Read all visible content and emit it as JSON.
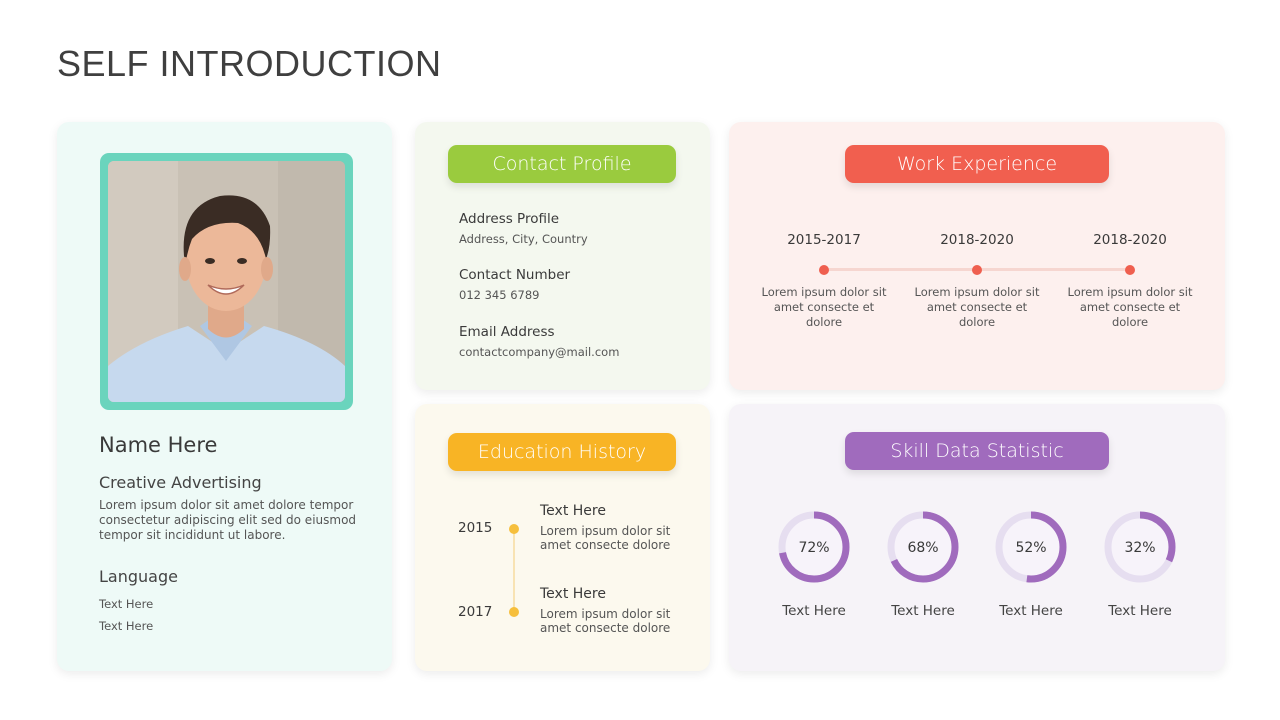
{
  "page": {
    "title": "SELF INTRODUCTION"
  },
  "colors": {
    "profile_bg": "#eefaf7",
    "photo_frame": "#6ad4bd",
    "contact_accent": "#9acb3e",
    "work_accent": "#f15f4f",
    "education_accent": "#f8b425",
    "skill_accent": "#a06bbd",
    "skill_track": "#e6def0"
  },
  "profile": {
    "photo_alt": "Smiling young man in light blue shirt",
    "name": "Name Here",
    "role": "Creative Advertising",
    "bio": "Lorem ipsum dolor sit amet dolore tempor consectetur adipiscing elit sed do eiusmod tempor  sit  incididunt ut labore.",
    "language_title": "Language",
    "languages": [
      "Text Here",
      "Text Here"
    ]
  },
  "contact": {
    "title": "Contact Profile",
    "items": [
      {
        "label": "Address Profile",
        "value": "Address,  City, Country"
      },
      {
        "label": "Contact Number",
        "value": "012 345 6789"
      },
      {
        "label": "Email Address",
        "value": "contactcompany@mail.com"
      }
    ]
  },
  "work": {
    "title": "Work Experience",
    "items": [
      {
        "years": "2015-2017",
        "desc": "Lorem ipsum dolor sit amet consecte et dolore"
      },
      {
        "years": "2018-2020",
        "desc": "Lorem ipsum dolor sit amet consecte et dolore"
      },
      {
        "years": "2018-2020",
        "desc": "Lorem ipsum dolor sit amet consecte et dolore"
      }
    ]
  },
  "education": {
    "title": "Education History",
    "items": [
      {
        "year": "2015",
        "title": "Text Here",
        "desc": "Lorem ipsum dolor sit amet consecte  dolore"
      },
      {
        "year": "2017",
        "title": "Text Here",
        "desc": "Lorem ipsum dolor sit amet consecte  dolore"
      }
    ]
  },
  "skills": {
    "title": "Skill Data Statistic",
    "items": [
      {
        "percent": 72,
        "display": "72%",
        "label": "Text Here"
      },
      {
        "percent": 68,
        "display": "68%",
        "label": "Text Here"
      },
      {
        "percent": 52,
        "display": "52%",
        "label": "Text Here"
      },
      {
        "percent": 32,
        "display": "32%",
        "label": "Text Here"
      }
    ]
  }
}
